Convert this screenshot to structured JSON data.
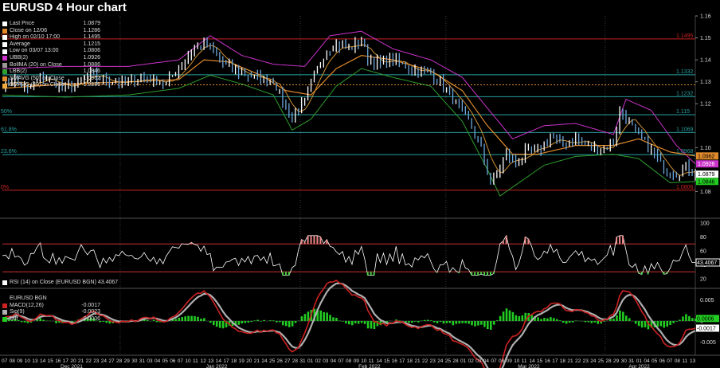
{
  "title": "EURUSD 4 Hour chart",
  "colors": {
    "background": "#000000",
    "price": "#ffffff",
    "bb_upper": "#cc33cc",
    "bb_lower": "#2e9e2e",
    "sma50": "#e08a2c",
    "sma20": "#f2a93b",
    "rsi_line": "#ffffff",
    "rsi_band": "#cc3333",
    "macd": "#cc2222",
    "signal": "#b0b0b0",
    "diff": "#22cc22",
    "last_price_tag": "#ffffff",
    "macd_tag": "#ffffff"
  },
  "legend": [
    {
      "label": "Last Price",
      "value": "1.0879",
      "color": "#ffffff"
    },
    {
      "label": "Close on 12/06",
      "value": "1.1286",
      "color": "#e08a2c"
    },
    {
      "label": "High on 02/10 17:00",
      "value": "1.1495",
      "color": "#ffffff"
    },
    {
      "label": "Average",
      "value": "1.1215",
      "color": "#ffffff"
    },
    {
      "label": "Low on 03/07 13:00",
      "value": "1.0806",
      "color": "#ffffff"
    },
    {
      "label": "UBB(2)",
      "value": "1.0926",
      "color": "#cc33cc"
    },
    {
      "label": "BollMA (20)  on Close",
      "value": "1.0886",
      "color": "#999999"
    },
    {
      "label": "LBB(2)",
      "value": "1.0846",
      "color": "#2e9e2e"
    },
    {
      "label": "SMAVG (50)  on Close",
      "value": "1.0962",
      "color": "#e08a2c"
    },
    {
      "label": "SMAVG (20)  on Close",
      "value": "1.0886",
      "color": "#f2a93b"
    }
  ],
  "rsi_label": "RSI (14)  on Close (EURUSD BGN) 43.4067",
  "rsi_value_tag": "43.4067",
  "macd_legend": [
    {
      "label": "EURUSD BGN",
      "value": "",
      "color": ""
    },
    {
      "label": "MACD(12,26)",
      "value": "-0.0017",
      "color": "#cc2222"
    },
    {
      "label": "Sig(9)",
      "value": "-0.0023",
      "color": "#b0b0b0"
    },
    {
      "label": "Diff",
      "value": "0.0006",
      "color": "#22cc22"
    }
  ],
  "price_tags": [
    {
      "text": "1.0962",
      "value": 1.0962,
      "bg": "#e08a2c",
      "fg": "#000000"
    },
    {
      "text": "1.0926",
      "value": 1.0926,
      "bg": "#cc33cc",
      "fg": "#ffffff"
    },
    {
      "text": "1.0879",
      "value": 1.0879,
      "bg": "#ffffff",
      "fg": "#000000"
    },
    {
      "text": "1.0846",
      "value": 1.0846,
      "bg": "#22cc22",
      "fg": "#000000"
    }
  ],
  "macd_tags": [
    {
      "text": "0.0006",
      "value": 0.0006,
      "bg": "#22cc22",
      "fg": "#000000"
    },
    {
      "text": "-0.0017",
      "value": -0.0017,
      "bg": "#ffffff",
      "fg": "#000000"
    }
  ],
  "chart_data": [
    {
      "type": "line",
      "panel": "price",
      "ylim": [
        1.07,
        1.16
      ],
      "yticks": [
        1.08,
        1.1,
        1.12,
        1.13,
        1.14,
        1.15,
        1.16
      ],
      "ytick_labels": [
        "1.08",
        "1.10",
        "1.12",
        "1.13",
        "1.14",
        "1.15",
        "1.16"
      ],
      "hlines": [
        {
          "value": 1.1495,
          "label": "1.1495",
          "left_label": "0%",
          "color": "#cc2222",
          "style": "solid"
        },
        {
          "value": 1.1332,
          "label": "1.1332",
          "left_label": "",
          "color": "#2aa0a0",
          "style": "solid"
        },
        {
          "value": 1.1286,
          "label": "",
          "left_label": "",
          "color": "#e08a2c",
          "style": "dotted"
        },
        {
          "value": 1.1232,
          "label": "1.1232",
          "left_label": "",
          "color": "#2aa0a0",
          "style": "solid"
        },
        {
          "value": 1.115,
          "label": "1.115",
          "left_label": "50%",
          "color": "#2aa0a0",
          "style": "solid"
        },
        {
          "value": 1.1069,
          "label": "1.1069",
          "left_label": "61.8%",
          "color": "#2aa0a0",
          "style": "solid"
        },
        {
          "value": 1.0968,
          "label": "1.0968",
          "left_label": "23.6%",
          "color": "#2aa0a0",
          "style": "solid"
        },
        {
          "value": 1.0806,
          "label": "1.0806",
          "left_label": "0%",
          "color": "#cc2222",
          "style": "solid"
        }
      ],
      "price_anchors": [
        [
          0,
          1.129
        ],
        [
          4,
          1.131
        ],
        [
          8,
          1.126
        ],
        [
          12,
          1.132
        ],
        [
          16,
          1.13
        ],
        [
          20,
          1.127
        ],
        [
          24,
          1.129
        ],
        [
          28,
          1.133
        ],
        [
          32,
          1.131
        ],
        [
          36,
          1.13
        ],
        [
          40,
          1.129
        ],
        [
          44,
          1.132
        ],
        [
          48,
          1.131
        ],
        [
          52,
          1.129
        ],
        [
          56,
          1.136
        ],
        [
          60,
          1.144
        ],
        [
          64,
          1.148
        ],
        [
          67,
          1.143
        ],
        [
          70,
          1.138
        ],
        [
          74,
          1.135
        ],
        [
          78,
          1.133
        ],
        [
          82,
          1.131
        ],
        [
          86,
          1.131
        ],
        [
          90,
          1.118
        ],
        [
          92,
          1.114
        ],
        [
          96,
          1.121
        ],
        [
          100,
          1.136
        ],
        [
          103,
          1.145
        ],
        [
          106,
          1.147
        ],
        [
          110,
          1.145
        ],
        [
          114,
          1.149
        ],
        [
          116,
          1.141
        ],
        [
          120,
          1.138
        ],
        [
          124,
          1.14
        ],
        [
          128,
          1.137
        ],
        [
          132,
          1.135
        ],
        [
          136,
          1.134
        ],
        [
          140,
          1.128
        ],
        [
          144,
          1.12
        ],
        [
          148,
          1.112
        ],
        [
          152,
          1.1
        ],
        [
          155,
          1.084
        ],
        [
          157,
          1.088
        ],
        [
          160,
          1.097
        ],
        [
          163,
          1.092
        ],
        [
          166,
          1.098
        ],
        [
          170,
          1.098
        ],
        [
          174,
          1.105
        ],
        [
          178,
          1.101
        ],
        [
          182,
          1.104
        ],
        [
          186,
          1.101
        ],
        [
          190,
          1.099
        ],
        [
          194,
          1.103
        ],
        [
          196,
          1.116
        ],
        [
          198,
          1.114
        ],
        [
          202,
          1.105
        ],
        [
          206,
          1.099
        ],
        [
          210,
          1.09
        ],
        [
          214,
          1.088
        ],
        [
          217,
          1.091
        ],
        [
          220,
          1.0879
        ]
      ],
      "sma50_anchors": [
        [
          0,
          1.127
        ],
        [
          20,
          1.129
        ],
        [
          40,
          1.13
        ],
        [
          56,
          1.131
        ],
        [
          64,
          1.14
        ],
        [
          72,
          1.139
        ],
        [
          82,
          1.133
        ],
        [
          90,
          1.126
        ],
        [
          98,
          1.124
        ],
        [
          106,
          1.136
        ],
        [
          114,
          1.142
        ],
        [
          124,
          1.14
        ],
        [
          136,
          1.135
        ],
        [
          146,
          1.126
        ],
        [
          154,
          1.11
        ],
        [
          162,
          1.097
        ],
        [
          170,
          1.097
        ],
        [
          182,
          1.101
        ],
        [
          194,
          1.101
        ],
        [
          202,
          1.104
        ],
        [
          212,
          1.098
        ],
        [
          220,
          1.0962
        ]
      ],
      "bb_upper_anchors": [
        [
          0,
          1.136
        ],
        [
          20,
          1.137
        ],
        [
          40,
          1.137
        ],
        [
          56,
          1.14
        ],
        [
          66,
          1.151
        ],
        [
          76,
          1.142
        ],
        [
          86,
          1.138
        ],
        [
          96,
          1.137
        ],
        [
          104,
          1.151
        ],
        [
          114,
          1.153
        ],
        [
          124,
          1.145
        ],
        [
          136,
          1.14
        ],
        [
          146,
          1.132
        ],
        [
          154,
          1.118
        ],
        [
          162,
          1.104
        ],
        [
          172,
          1.11
        ],
        [
          182,
          1.111
        ],
        [
          194,
          1.106
        ],
        [
          198,
          1.122
        ],
        [
          206,
          1.117
        ],
        [
          214,
          1.101
        ],
        [
          220,
          1.0926
        ]
      ],
      "bb_lower_anchors": [
        [
          0,
          1.124
        ],
        [
          20,
          1.123
        ],
        [
          40,
          1.124
        ],
        [
          56,
          1.127
        ],
        [
          66,
          1.133
        ],
        [
          76,
          1.129
        ],
        [
          86,
          1.124
        ],
        [
          92,
          1.108
        ],
        [
          98,
          1.113
        ],
        [
          106,
          1.128
        ],
        [
          114,
          1.136
        ],
        [
          124,
          1.132
        ],
        [
          136,
          1.128
        ],
        [
          146,
          1.112
        ],
        [
          154,
          1.09
        ],
        [
          158,
          1.078
        ],
        [
          164,
          1.084
        ],
        [
          172,
          1.092
        ],
        [
          182,
          1.096
        ],
        [
          194,
          1.097
        ],
        [
          202,
          1.095
        ],
        [
          212,
          1.084
        ],
        [
          220,
          1.0846
        ]
      ]
    },
    {
      "type": "line",
      "panel": "rsi",
      "ylim": [
        20,
        100
      ],
      "yticks": [
        20,
        40,
        60,
        80,
        100
      ],
      "ytick_labels": [
        "20",
        "40",
        "60",
        "80",
        "100"
      ],
      "bands": [
        70,
        30
      ],
      "last": 43.4067
    },
    {
      "type": "bar",
      "panel": "macd",
      "ylim": [
        -0.007,
        0.007
      ],
      "yticks": [
        0.005,
        0,
        -0.005
      ],
      "ytick_labels": [
        "0.005",
        "0",
        "-0.005"
      ],
      "macd_last": -0.0017,
      "signal_last": -0.0023,
      "diff_last": 0.0006
    }
  ],
  "x_axis": {
    "tick_labels": [
      "07",
      "08",
      "09",
      "10",
      "13",
      "14",
      "15",
      "16",
      "17",
      "20",
      "21",
      "22",
      "23",
      "24",
      "27",
      "28",
      "29",
      "30",
      "31",
      "03",
      "04",
      "05",
      "06",
      "07",
      "10",
      "11",
      "12",
      "13",
      "14",
      "17",
      "18",
      "19",
      "20",
      "21",
      "24",
      "25",
      "26",
      "27",
      "28",
      "31",
      "01",
      "02",
      "03",
      "04",
      "07",
      "08",
      "09",
      "10",
      "11",
      "14",
      "15",
      "16",
      "17",
      "18",
      "21",
      "22",
      "23",
      "24",
      "25",
      "28",
      "01",
      "02",
      "03",
      "04",
      "07",
      "08",
      "09",
      "10",
      "11",
      "14",
      "15",
      "16",
      "17",
      "18",
      "21",
      "22",
      "23",
      "24",
      "25",
      "28",
      "29",
      "30",
      "31",
      "01",
      "04",
      "05",
      "06",
      "07",
      "08",
      "11",
      "13"
    ],
    "months": [
      {
        "label": "Dec 2021",
        "at": 0.1
      },
      {
        "label": "Jan 2022",
        "at": 0.31
      },
      {
        "label": "Feb 2022",
        "at": 0.53
      },
      {
        "label": "Mar 2022",
        "at": 0.76
      },
      {
        "label": "Apr 2022",
        "at": 0.92
      }
    ]
  }
}
